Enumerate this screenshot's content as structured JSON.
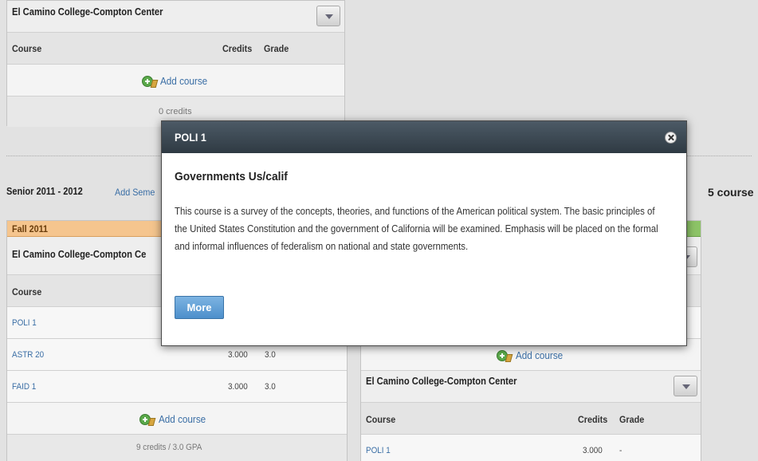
{
  "top_block": {
    "school": "El Camino College-Compton Center",
    "col_course": "Course",
    "col_credits": "Credits",
    "col_grade": "Grade",
    "add_course": "Add course",
    "credits_summary": "0 credits"
  },
  "year_header": {
    "label": "Senior 2011 - 2012",
    "add_semester": "Add Seme",
    "courses_count": "5 course"
  },
  "fall": {
    "label": "Fall 2011",
    "school": "El Camino College-Compton Ce",
    "col_course": "Course",
    "rows": [
      {
        "course": "POLI 1",
        "credits": "",
        "grade": ""
      },
      {
        "course": "ASTR 20",
        "credits": "3.000",
        "grade": "3.0"
      },
      {
        "course": "FAID 1",
        "credits": "3.000",
        "grade": "3.0"
      }
    ],
    "add_course": "Add course",
    "summary": "9 credits / 3.0 GPA"
  },
  "right_block": {
    "add_course": "Add course",
    "school": "El Camino College-Compton Center",
    "col_course": "Course",
    "col_credits": "Credits",
    "col_grade": "Grade",
    "rows": [
      {
        "course": "POLI 1",
        "credits": "3.000",
        "grade": "-"
      }
    ]
  },
  "modal": {
    "title": "POLI 1",
    "course_name": "Governments Us/calif",
    "description": "This course is a survey of the concepts, theories, and functions of the American political system. The basic principles of the United States Constitution and the government of California will be examined. Emphasis will be placed on the formal and informal influences of federalism on national and state governments.",
    "more_label": "More"
  },
  "colors": {
    "fall_bar": "#f5c58e",
    "spring_bar": "#8dc467",
    "modal_header": "#3a4651",
    "button": "#5b9bd5"
  }
}
